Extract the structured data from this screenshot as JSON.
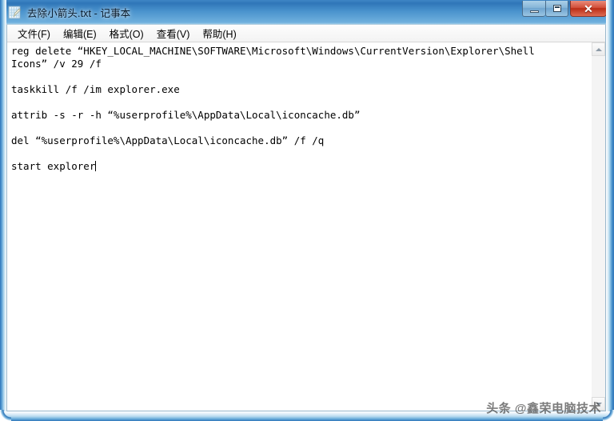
{
  "window": {
    "title": "去除小箭头.txt - 记事本",
    "icon": "notepad-document-icon",
    "controls": {
      "minimize_label": "最小化",
      "maximize_label": "最大化",
      "close_label": "✕"
    },
    "colors": {
      "frame_blue": "#2f76b8",
      "titlebar_gradient_top": "#3f86c4",
      "close_red": "#bb2d16",
      "client_white": "#ffffff",
      "text_black": "#000000"
    }
  },
  "menubar": {
    "items": [
      {
        "label": "文件(F)"
      },
      {
        "label": "编辑(E)"
      },
      {
        "label": "格式(O)"
      },
      {
        "label": "查看(V)"
      },
      {
        "label": "帮助(H)"
      }
    ]
  },
  "editor": {
    "lines": [
      {
        "text": "reg delete “HKEY_LOCAL_MACHINE\\SOFTWARE\\Microsoft\\Windows\\CurrentVersion\\Explorer\\Shell",
        "wrapped": true
      },
      {
        "text": "Icons” /v 29 /f",
        "wrapped": false
      },
      {
        "text": "",
        "wrapped": false
      },
      {
        "text": "taskkill /f /im explorer.exe",
        "wrapped": false
      },
      {
        "text": "",
        "wrapped": false
      },
      {
        "text": "attrib -s -r -h “%userprofile%\\AppData\\Local\\iconcache.db”",
        "wrapped": false
      },
      {
        "text": "",
        "wrapped": false
      },
      {
        "text": "del “%userprofile%\\AppData\\Local\\iconcache.db” /f /q",
        "wrapped": false
      },
      {
        "text": "",
        "wrapped": false
      },
      {
        "text": "start explorer",
        "wrapped": false,
        "caret_after": true
      }
    ]
  },
  "scrollbar": {
    "up_arrow": "scroll-up-arrow-icon",
    "down_arrow": "scroll-down-arrow-icon",
    "orientation": "vertical"
  },
  "watermark": {
    "text": "头条 @鑫荣电脑技术"
  }
}
